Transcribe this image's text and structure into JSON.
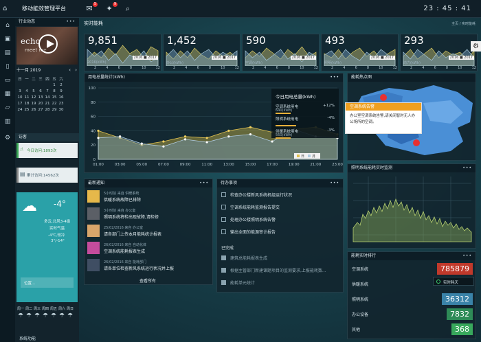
{
  "app": {
    "title": "移动能效管理平台",
    "clock": "23 : 45 : 41",
    "mail_badge": "5",
    "alert_badge": "9"
  },
  "left": {
    "news_title": "行业动态",
    "video_caption": "echo",
    "video_sub": "meet me",
    "cal_title": "十一月 2019",
    "cal_weekdays": [
      "日",
      "一",
      "二",
      "三",
      "四",
      "五",
      "六"
    ],
    "cal_rows": [
      [
        "",
        "",
        "",
        "",
        "",
        "1",
        "2"
      ],
      [
        "3",
        "4",
        "5",
        "6",
        "7",
        "8",
        "9"
      ],
      [
        "10",
        "11",
        "12",
        "13",
        "14",
        "15",
        "16"
      ],
      [
        "17",
        "18",
        "19",
        "20",
        "21",
        "22",
        "23"
      ],
      [
        "24",
        "25",
        "26",
        "27",
        "28",
        "29",
        "30"
      ]
    ],
    "visits_title": "访客",
    "today_visits": "今日访问:1893次",
    "total_visits": "累计访问:14562次",
    "weather_temp": "-4°",
    "weather_desc": [
      "多云,北风3-4级",
      "实时气温",
      "-4℃,较冷",
      "3°/-14°"
    ],
    "location_placeholder": "位置...",
    "forecast_days": [
      "周一",
      "周二",
      "周三",
      "周四",
      "周五",
      "周六",
      "周日"
    ],
    "bottom_link": "系统功能"
  },
  "realtime": {
    "title": "实时能耗",
    "breadcrumb": "主页 / 实时能耗",
    "cards": [
      {
        "value": "9,851",
        "unit": "2016(kWh)",
        "legend": "2016 ■ 2017"
      },
      {
        "value": "1,452",
        "unit": "办公(kWh)",
        "legend": "2016 ■ 2017"
      },
      {
        "value": "590",
        "unit": "空调(kWh)",
        "legend": "2016 ■ 2017"
      },
      {
        "value": "493",
        "unit": "照明(kWh)",
        "legend": "2016 ■ 2017"
      },
      {
        "value": "293",
        "unit": "动力(kWh)",
        "legend": "2016 ■ 2017"
      }
    ],
    "x_ticks": [
      "2",
      "4",
      "6",
      "8",
      "10",
      "12"
    ]
  },
  "usage": {
    "title": "用电总量统计(kWh)",
    "today_title": "今日用电总量(kWh)",
    "items": [
      {
        "label": "空调系统用电",
        "value": "640(kWh)",
        "change": "+12%"
      },
      {
        "label": "照明系统用电",
        "value": "",
        "change": "-4%"
      },
      {
        "label": "供暖系统用电",
        "value": "560(kWh)",
        "change": "-3%"
      }
    ],
    "legend": [
      "日",
      "月"
    ]
  },
  "heatmap": {
    "title": "能耗热点图",
    "popup_title": "空调系统告警",
    "popup_text": "办公室空调系统告警,请关闭智时无人办公场所的空调。"
  },
  "notices": {
    "title": "最新通知",
    "view_all": "查看所有",
    "items": [
      {
        "meta": "5小时前 来自 供暖系统",
        "text": "供暖系统故障已排除"
      },
      {
        "meta": "3小时前 来自 办公室",
        "text": "照明系统将检出现故障,请检修"
      },
      {
        "meta": "25/02/2016 来自 办公室",
        "text": "请各部门上传本月能耗统计报表"
      },
      {
        "meta": "26/02/2016 来自 自动化体",
        "text": "空调系统能耗报表生成"
      },
      {
        "meta": "26/02/2016 来自 能耗部门",
        "text": "请各单位检查新风系统运行状况并上报"
      }
    ]
  },
  "todo": {
    "title": "待办事项",
    "done_title": "已完成",
    "pending": [
      "检查办公楼新风系统机组运行状况",
      "空调系统能耗监测报告提交",
      "处理办公楼照明系统告警",
      "输出全面的能源审计报告"
    ],
    "completed": [
      "建筑总能耗报表生成",
      "根据主管部门新建课题项目的监测要求,上报能耗数...",
      "能耗单元统计"
    ]
  },
  "lighting": {
    "title": "照明系统能耗实时监测"
  },
  "ranking": {
    "title": "能耗实时排行",
    "realtime_label": "实时耗天",
    "items": [
      {
        "name": "空调系统",
        "value": "785879",
        "color": "#c0392b"
      },
      {
        "name": "供暖系统",
        "value": "",
        "color": "#1e2e36"
      },
      {
        "name": "照明系统",
        "value": "36312",
        "color": "#3a83a8"
      },
      {
        "name": "办公设备",
        "value": "7832",
        "color": "#2e8b57"
      },
      {
        "name": "其他",
        "value": "368",
        "color": "#38a85c"
      }
    ]
  },
  "chart_data": [
    {
      "type": "line",
      "title": "用电总量统计(kWh)",
      "categories": [
        "01:00",
        "03:00",
        "05:00",
        "07:00",
        "09:00",
        "11:00",
        "13:00",
        "15:00",
        "17:00",
        "19:00",
        "21:00",
        "23:00"
      ],
      "series": [
        {
          "name": "日",
          "values": [
            40,
            30,
            20,
            25,
            32,
            30,
            40,
            45,
            38,
            42,
            45,
            35
          ]
        },
        {
          "name": "月",
          "values": [
            30,
            32,
            22,
            18,
            28,
            24,
            32,
            35,
            25,
            42,
            32,
            30
          ]
        }
      ],
      "ylim": [
        0,
        100
      ],
      "yticks": [
        0,
        20,
        40,
        60,
        80,
        100
      ]
    }
  ]
}
